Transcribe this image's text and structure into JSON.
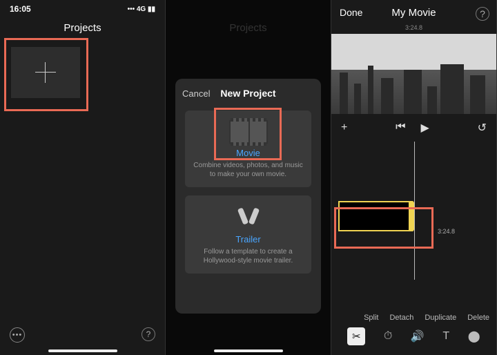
{
  "panel1": {
    "status": {
      "time": "16:05",
      "signal": "••• 4G ▮▮"
    },
    "header": "Projects",
    "add_tile_icon": "plus-icon"
  },
  "panel2": {
    "header_behind": "Projects",
    "modal": {
      "cancel": "Cancel",
      "title": "New Project",
      "movie": {
        "label": "Movie",
        "desc": "Combine videos, photos, and music to make your own movie."
      },
      "trailer": {
        "label": "Trailer",
        "desc": "Follow a template to create a Hollywood-style movie trailer."
      }
    }
  },
  "panel3": {
    "done": "Done",
    "title": "My Movie",
    "timecode_top": "3:24.8",
    "timecode_clip": "3:24.8",
    "actions": {
      "split": "Split",
      "detach": "Detach",
      "duplicate": "Duplicate",
      "delete": "Delete"
    },
    "tools": {
      "scissors": "✂",
      "speed": "⏱",
      "volume": "🔊",
      "text": "T",
      "filters": "⬤"
    },
    "playback": {
      "add": "+",
      "start": "⏮",
      "play": "▶",
      "undo": "↺"
    }
  },
  "highlight_color": "#e96a55"
}
